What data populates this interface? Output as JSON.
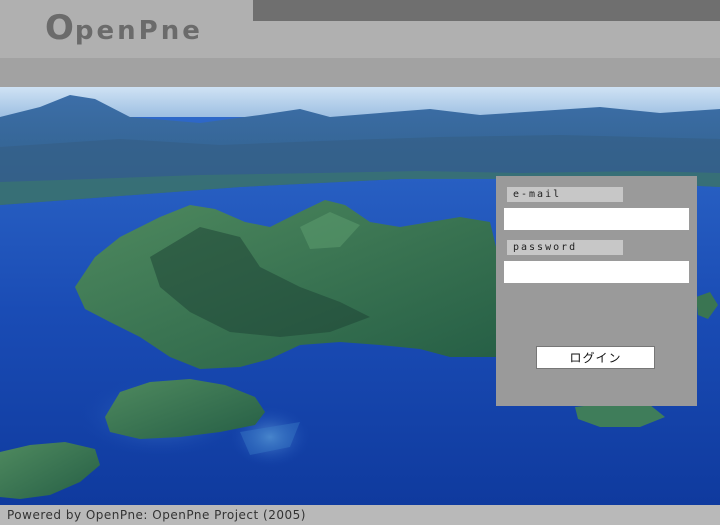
{
  "header": {
    "logo_first": "O",
    "logo_rest": "penPne"
  },
  "hero": {
    "image": "aerial-lake-islands-photo"
  },
  "login": {
    "email_label": "e-mail",
    "email_value": "",
    "password_label": "password",
    "password_value": "",
    "submit_label": "ログイン"
  },
  "footer": {
    "text": "Powered by OpenPne: OpenPne Project (2005)"
  },
  "colors": {
    "header_bg": "#b0b0b0",
    "header_dark_band": "#6f6f6f",
    "panel_bg": "#9a9a9a",
    "logo_text": "#6b6b6b",
    "water": "#1c4fb8",
    "land": "#2e6b4a"
  }
}
